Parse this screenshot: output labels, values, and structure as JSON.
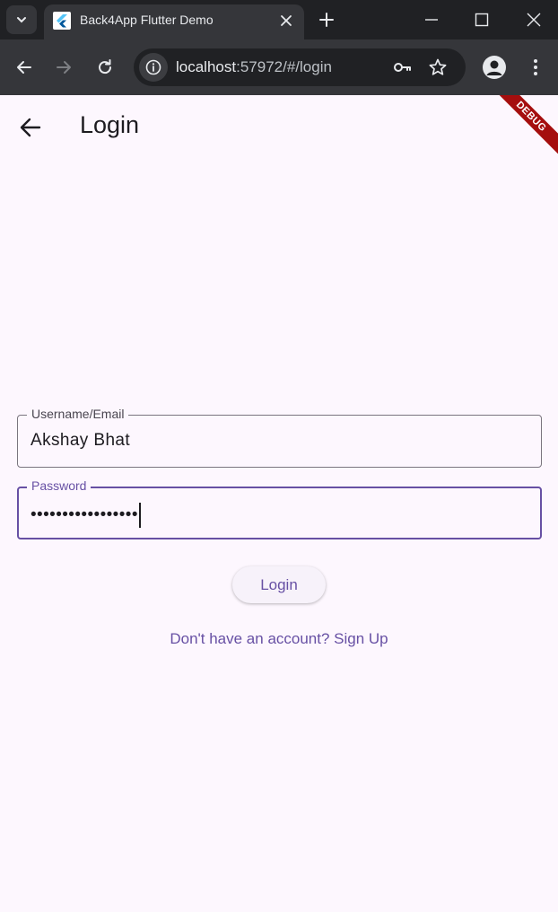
{
  "browser": {
    "tab_title": "Back4App Flutter Demo",
    "url_host": "localhost",
    "url_rest": ":57972/#/login"
  },
  "app": {
    "title": "Login",
    "debug_banner": "DEBUG",
    "username_label": "Username/Email",
    "username_value": "Akshay Bhat",
    "password_label": "Password",
    "password_value": "•••••••••••••••••",
    "login_button": "Login",
    "signup_link": "Don't have an account? Sign Up"
  },
  "colors": {
    "primary": "#6750a4",
    "background": "#fdf7fe",
    "debug_banner": "#a50e0e"
  }
}
